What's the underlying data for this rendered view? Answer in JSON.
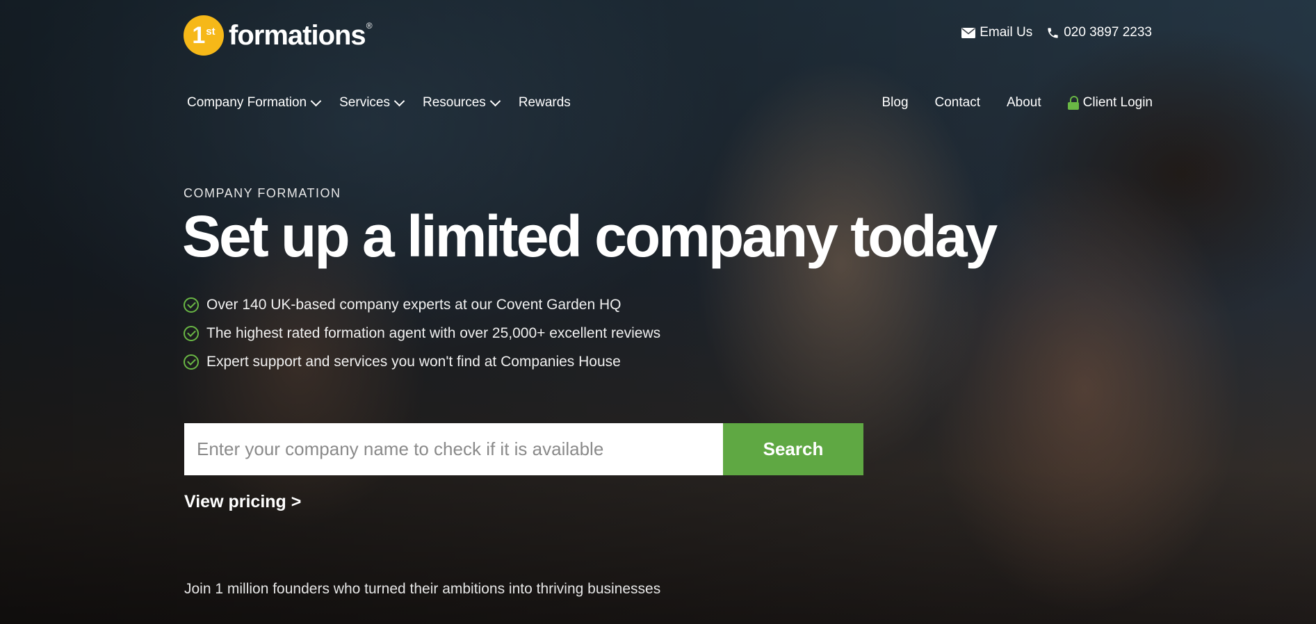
{
  "brand": {
    "badge_text": "1",
    "badge_sup": "st",
    "name": "formations",
    "registered_mark": "®",
    "badge_color": "#f6b818"
  },
  "contact": {
    "email_label": "Email Us",
    "phone_label": "020 3897 2233"
  },
  "nav_left": [
    {
      "label": "Company Formation",
      "has_dropdown": true
    },
    {
      "label": "Services",
      "has_dropdown": true
    },
    {
      "label": "Resources",
      "has_dropdown": true
    },
    {
      "label": "Rewards",
      "has_dropdown": false
    }
  ],
  "nav_right": {
    "blog": "Blog",
    "contact": "Contact",
    "about": "About",
    "client_login": "Client Login"
  },
  "hero": {
    "eyebrow": "COMPANY FORMATION",
    "headline": "Set up a limited company today",
    "bullets": [
      "Over 140 UK-based company experts at our Covent Garden HQ",
      "The highest rated formation agent with over 25,000+ excellent reviews",
      "Expert support and services you won't find at Companies House"
    ]
  },
  "search": {
    "placeholder": "Enter your company name to check if it is available",
    "value": "",
    "button_label": "Search"
  },
  "pricing_link": "View pricing >",
  "tagline": "Join 1 million founders who turned their ambitions into thriving businesses",
  "colors": {
    "accent_green": "#5fa843",
    "check_green": "#6ab845"
  }
}
